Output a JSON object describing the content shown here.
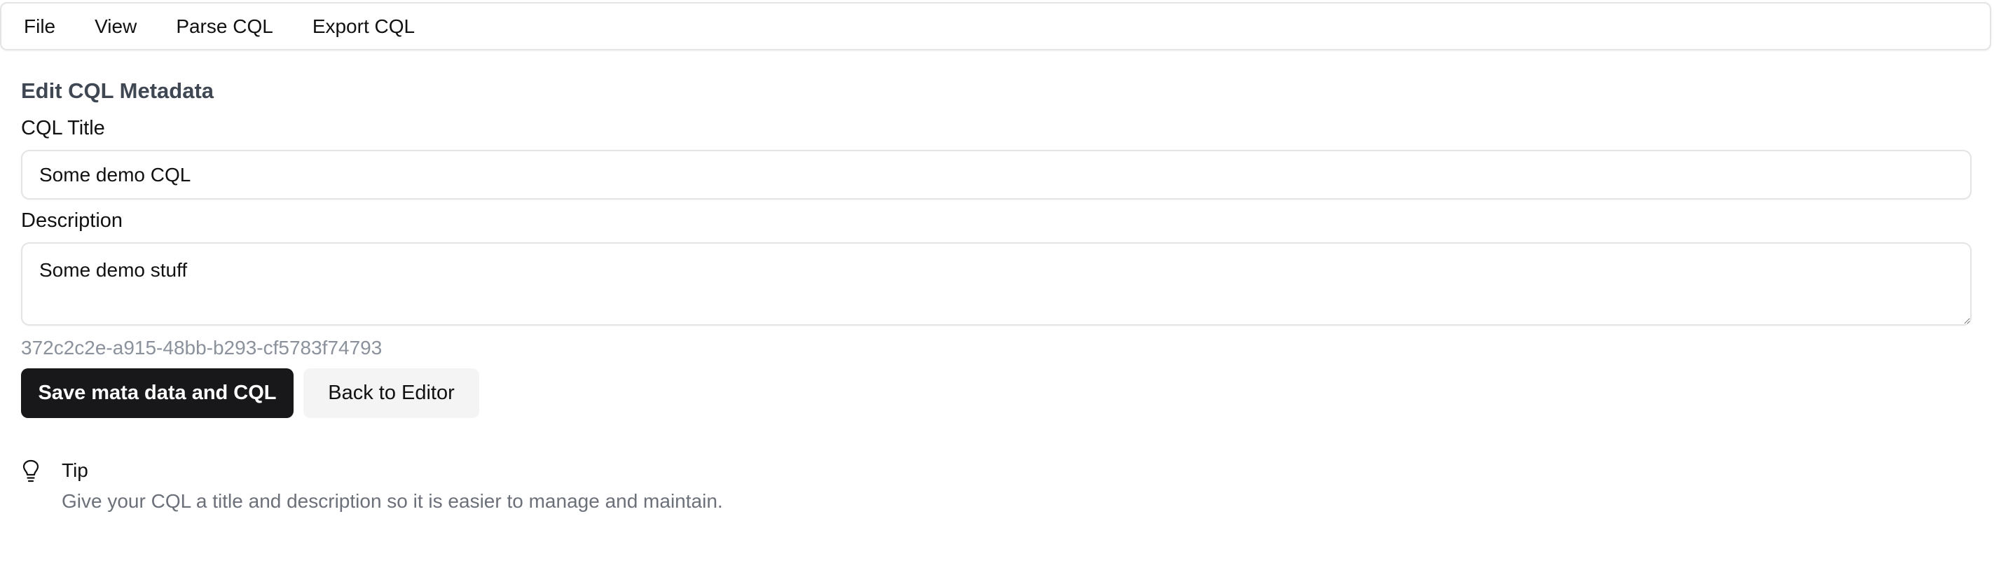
{
  "menubar": {
    "items": [
      "File",
      "View",
      "Parse CQL",
      "Export CQL"
    ]
  },
  "form": {
    "section_title": "Edit CQL Metadata",
    "title_label": "CQL Title",
    "title_value": "Some demo CQL",
    "description_label": "Description",
    "description_value": "Some demo stuff",
    "uuid": "372c2c2e-a915-48bb-b293-cf5783f74793"
  },
  "actions": {
    "save_label": "Save mata data and CQL",
    "back_label": "Back to Editor"
  },
  "tip": {
    "icon": "lightbulb-icon",
    "title": "Tip",
    "body": "Give your CQL a title and description so it is easier to manage and maintain."
  },
  "colors": {
    "primary_button": "#18181b",
    "secondary_button": "#f4f4f5",
    "muted_text": "#8b929c"
  }
}
